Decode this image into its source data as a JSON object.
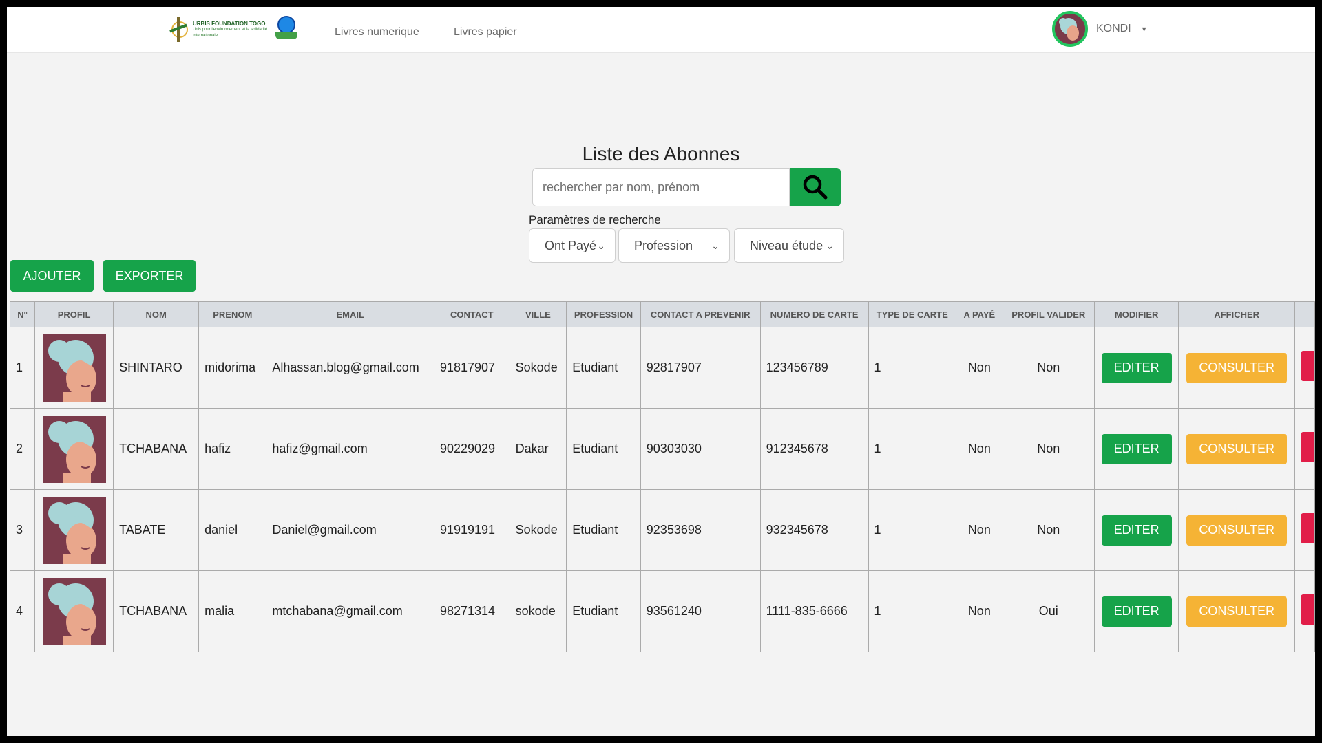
{
  "navbar": {
    "logo_line1": "URBIS FOUNDATION TOGO",
    "logo_line2": "Unis pour l'environnement et la solidarité internationale",
    "links": [
      "Livres numerique",
      "Livres papier"
    ],
    "user_name": "KONDI"
  },
  "main": {
    "title": "Liste des Abonnes",
    "search_placeholder": "rechercher par nom, prénom",
    "params_label": "Paramètres de recherche",
    "filters": [
      "Ont Payé",
      "Profession",
      "Niveau étude"
    ],
    "buttons": {
      "add": "AJOUTER",
      "export": "EXPORTER"
    }
  },
  "table": {
    "headers": [
      "N°",
      "PROFIL",
      "NOM",
      "PRENOM",
      "EMAIL",
      "CONTACT",
      "VILLE",
      "PROFESSION",
      "CONTACT A PREVENIR",
      "NUMERO DE CARTE",
      "TYPE DE CARTE",
      "A PAYÉ",
      "PROFIL VALIDER",
      "MODIFIER",
      "AFFICHER"
    ],
    "edit_label": "EDITER",
    "view_label": "CONSULTER",
    "rows": [
      {
        "n": "1",
        "nom": "SHINTARO",
        "prenom": "midorima",
        "email": "Alhassan.blog@gmail.com",
        "contact": "91817907",
        "ville": "Sokode",
        "profession": "Etudiant",
        "prevenir": "92817907",
        "carte": "123456789",
        "type": "1",
        "paye": "Non",
        "valide": "Non"
      },
      {
        "n": "2",
        "nom": "TCHABANA",
        "prenom": "hafiz",
        "email": "hafiz@gmail.com",
        "contact": "90229029",
        "ville": "Dakar",
        "profession": "Etudiant",
        "prevenir": "90303030",
        "carte": "912345678",
        "type": "1",
        "paye": "Non",
        "valide": "Non"
      },
      {
        "n": "3",
        "nom": "TABATE",
        "prenom": "daniel",
        "email": "Daniel@gmail.com",
        "contact": "91919191",
        "ville": "Sokode",
        "profession": "Etudiant",
        "prevenir": "92353698",
        "carte": "932345678",
        "type": "1",
        "paye": "Non",
        "valide": "Non"
      },
      {
        "n": "4",
        "nom": "TCHABANA",
        "prenom": "malia",
        "email": "mtchabana@gmail.com",
        "contact": "98271314",
        "ville": "sokode",
        "profession": "Etudiant",
        "prevenir": "93561240",
        "carte": "1111-835-6666",
        "type": "1",
        "paye": "Non",
        "valide": "Oui"
      }
    ]
  },
  "colors": {
    "primary": "#16a34a",
    "warning": "#f5b335",
    "danger": "#dc2626"
  }
}
